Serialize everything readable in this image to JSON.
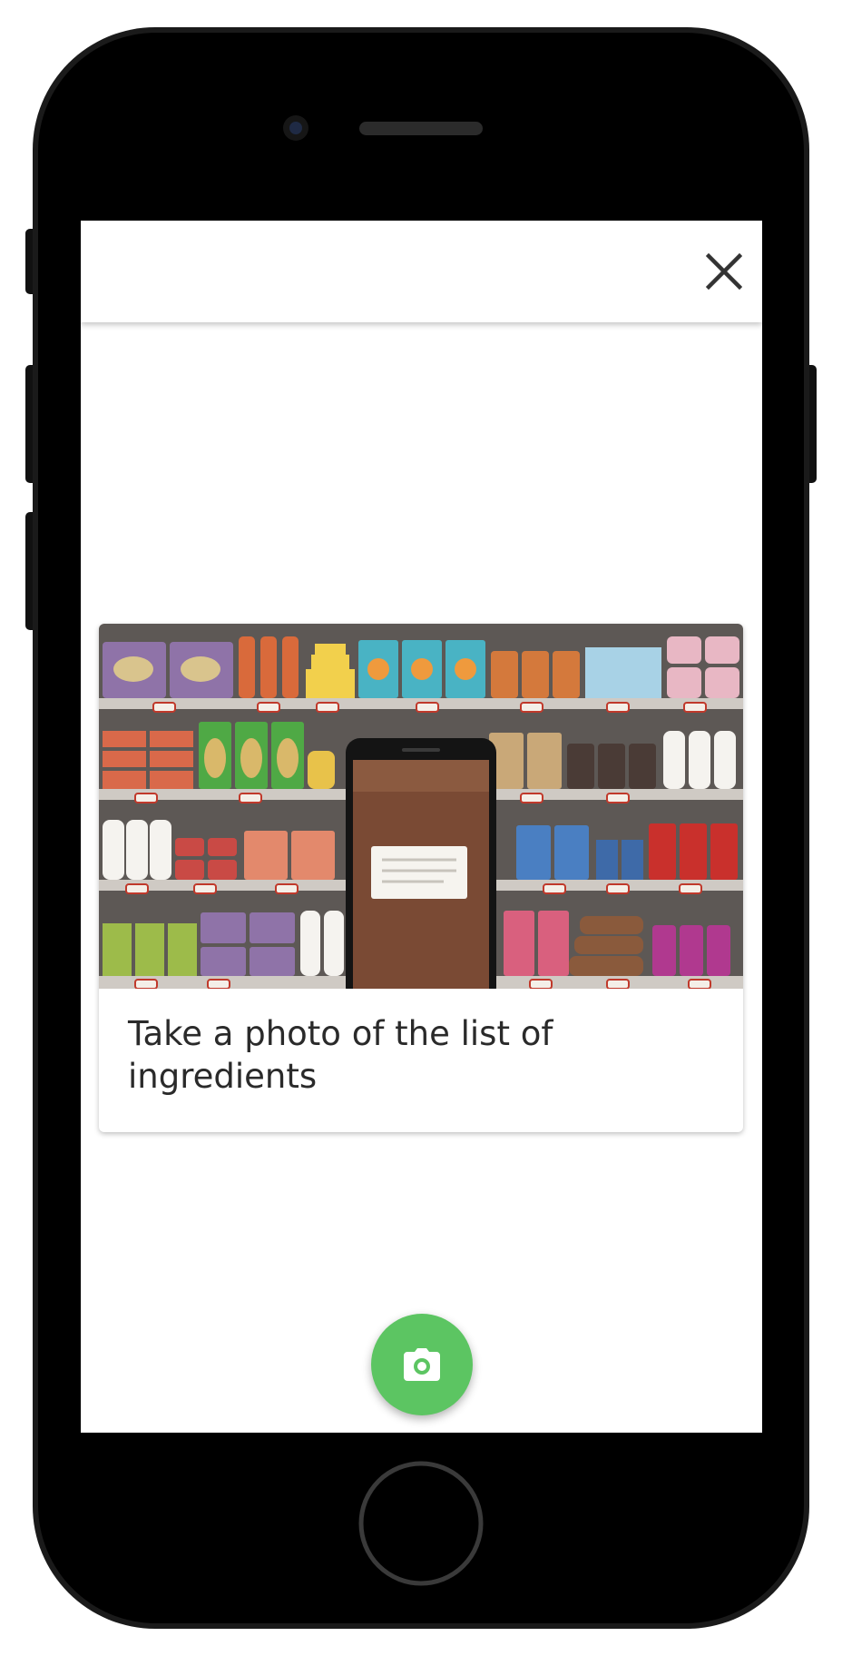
{
  "app": {
    "close_label": "Close",
    "card": {
      "title": "Take a photo of the list of ingredients",
      "illustration": "phone-scanning-product-on-supermarket-shelves"
    },
    "fab": {
      "icon": "camera-icon",
      "label": "Take photo"
    }
  },
  "device": {
    "model": "iphone",
    "frame_color": "#000000"
  },
  "colors": {
    "accent": "#5cc562",
    "text": "#2a2a2a",
    "icon": "#333333",
    "shelf_wall": "#5d5855"
  }
}
